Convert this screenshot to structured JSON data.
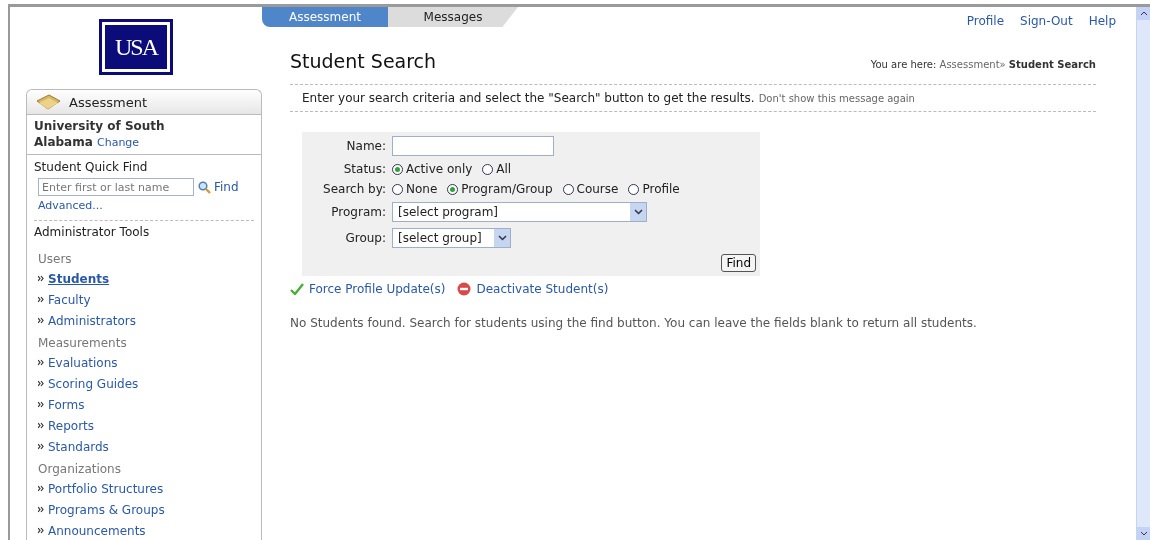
{
  "logo": {
    "text": "USA"
  },
  "tabs": [
    {
      "label": "Assessment",
      "selected": true
    },
    {
      "label": "Messages",
      "selected": false
    }
  ],
  "top_links": [
    "Profile",
    "Sign-Out",
    "Help"
  ],
  "sidebar": {
    "header": "Assessment",
    "institution": "University of South Alabama",
    "change_link": "Change",
    "quick_find": {
      "title": "Student Quick Find",
      "placeholder": "Enter first or last name",
      "find": "Find",
      "advanced": "Advanced..."
    },
    "tools_title": "Administrator Tools",
    "groups": [
      {
        "title": "Users",
        "items": [
          {
            "label": "Students",
            "selected": true
          },
          {
            "label": "Faculty",
            "selected": false
          },
          {
            "label": "Administrators",
            "selected": false
          }
        ]
      },
      {
        "title": "Measurements",
        "items": [
          {
            "label": "Evaluations",
            "selected": false
          },
          {
            "label": "Scoring Guides",
            "selected": false
          },
          {
            "label": "Forms",
            "selected": false
          },
          {
            "label": "Reports",
            "selected": false
          },
          {
            "label": "Standards",
            "selected": false
          }
        ]
      },
      {
        "title": "Organizations",
        "items": [
          {
            "label": "Portfolio Structures",
            "selected": false
          },
          {
            "label": "Programs & Groups",
            "selected": false
          },
          {
            "label": "Announcements",
            "selected": false
          }
        ]
      }
    ]
  },
  "page_title": "Student Search",
  "breadcrumb": {
    "prefix": "You are here:",
    "parent": "Assessment»",
    "current": "Student Search"
  },
  "message": {
    "text": "Enter your search criteria and select the \"Search\" button to get the results.",
    "dismiss": "Don't show this message again"
  },
  "form": {
    "name_label": "Name:",
    "status_label": "Status:",
    "status_options": [
      {
        "label": "Active only",
        "selected": true
      },
      {
        "label": "All",
        "selected": false
      }
    ],
    "search_by_label": "Search by:",
    "search_by_options": [
      {
        "label": "None",
        "selected": false
      },
      {
        "label": "Program/Group",
        "selected": true
      },
      {
        "label": "Course",
        "selected": false
      },
      {
        "label": "Profile",
        "selected": false
      }
    ],
    "program_label": "Program:",
    "program_value": "[select program]",
    "group_label": "Group:",
    "group_value": "[select group]",
    "find_button": "Find"
  },
  "actions": [
    {
      "kind": "check",
      "label": "Force Profile Update(s)"
    },
    {
      "kind": "stop",
      "label": "Deactivate Student(s)"
    }
  ],
  "result_message": "No Students found. Search for students using the find button. You can leave the fields blank to return all students."
}
